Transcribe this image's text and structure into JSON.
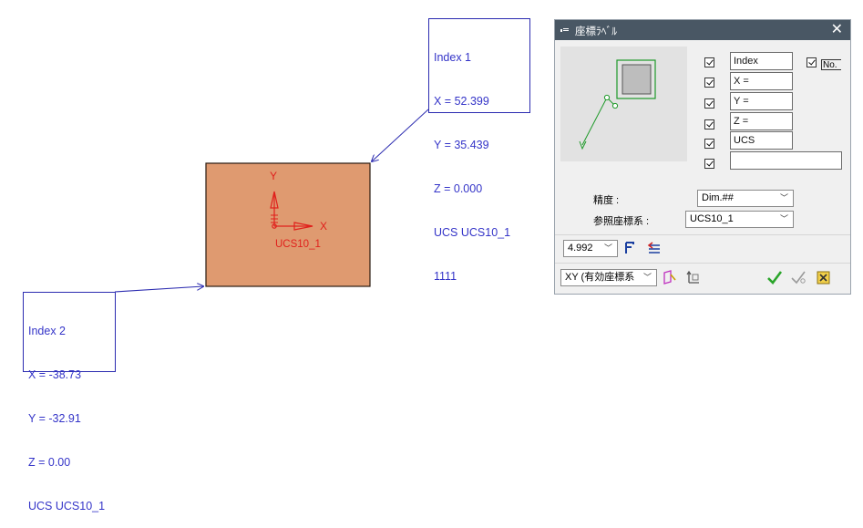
{
  "labels": {
    "index1": [
      "Index 1",
      "X = 52.399",
      "Y = 35.439",
      "Z = 0.000",
      "UCS UCS10_1",
      "1111"
    ],
    "index2": [
      "Index 2",
      "X = -38.73",
      "Y = -32.91",
      "Z = 0.00",
      "UCS UCS10_1"
    ]
  },
  "ucs": {
    "x_axis": "X",
    "y_axis": "Y",
    "name": "UCS10_1"
  },
  "colors": {
    "rect_fill": "#df9a70",
    "axis": "#e0201c",
    "label_text": "#3434c8",
    "leader": "#2b2bb0",
    "titlebar": "#495764"
  },
  "dialog": {
    "title": "座標ﾗﾍﾞﾙ",
    "close_icon": "close-icon",
    "fields": [
      "Index",
      "X =",
      "Y =",
      "Z =",
      "UCS",
      ""
    ],
    "checked": [
      true,
      true,
      true,
      true,
      true,
      true
    ],
    "no_checked": true,
    "no_label": "No.",
    "precision_label": "精度 :",
    "precision_value": "Dim.##",
    "ref_coord_label": "参照座標系 :",
    "ref_coord_value": "UCS10_1",
    "size_value": "4.992",
    "plane_value": "XY (有効座標系"
  }
}
